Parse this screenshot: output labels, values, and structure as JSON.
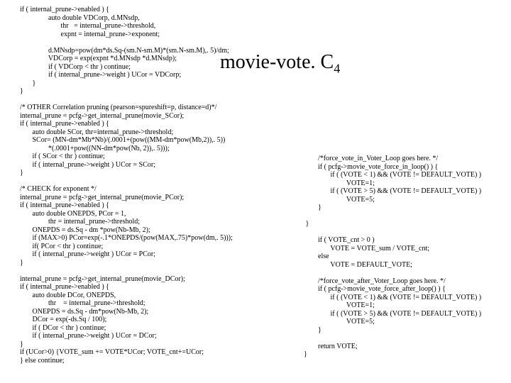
{
  "title_main": "movie-vote. C",
  "title_sub": "4",
  "code_left": "        if ( internal_prune->enabled ) {\n                        auto double VDCorp, d.MNsdp,\n                               thr   = internal_prune->threshold,\n                               expnt = internal_prune->exponent;\n\n                        d.MNsdp=pow(dm*ds.Sq-(sm.N-sm.M)*(sm.N-sm.M),. 5)/dm;\n                        VDCorp = exp(expnt *d.MNsdp *d.MNsdp);\n                        if ( VDCorp < thr ) continue;\n                        if ( internal_prune->weight ) UCor = VDCorp;\n               }\n        }\n\n        /* OTHER Correlation pruning (pearson=spureshift=p, distance=d)*/\n        internal_prune = pcfg->get_internal_prune(movie_SCor);\n        if ( internal_prune->enabled ) {\n               auto double SCor, thr=internal_prune->threshold;\n               SCor= (MN-dm*Mb*Nb)/(.0001+(pow((MM-dm*pow(Mb,2)),. 5))\n                        *(.0001+pow((NN-dm*pow(Nb, 2)),. 5)));\n               if ( SCor < thr ) continue;\n               if ( internal_prune->weight ) UCor = SCor;\n        }\n\n        /* CHECK for exponent */\n        internal_prune = pcfg->get_internal_prune(movie_PCor);\n        if ( internal_prune->enabled ) {\n               auto double ONEPDS, PCor = 1,\n                        thr = internal_prune->threshold;\n               ONEPDS = ds.Sq - dm *pow(Nb-Mb, 2);\n               if (MAX>0) PCor=exp(-.1*ONEPDS/(pow(MAX,.75)*pow(dm,. 5)));\n               if( PCor < thr ) continue;\n               if ( internal_prune->weight ) UCor = PCor;\n        }\n\n        internal_prune = pcfg->get_internal_prune(movie_DCor);\n        if ( internal_prune->enabled ) {\n               auto double DCor, ONEPDS,\n                        thr    = internal_prune->threshold;\n               ONEPDS = ds.Sq - dm*pow(Nb-Mb, 2);\n               DCor = exp(-ds.Sq / 100);\n               if ( DCor < thr ) continue;\n               if ( internal_prune->weight ) UCor = DCor;\n        }\n        if (UCor>0) {VOTE_sum += VOTE*UCor; VOTE_cnt+=UCor;\n        } else continue;",
  "code_right": "        /*force_vote_in_Voter_Loop goes here. */\n        if ( pcfg->movie_vote_force_in_loop() ) {\n               if ( (VOTE < 1) && (VOTE != DEFAULT_VOTE) )\n                        VOTE=1;\n               if ( (VOTE > 5) && (VOTE != DEFAULT_VOTE) )\n                        VOTE=5;\n        }\n\n }\n\n        if ( VOTE_cnt > 0 )\n               VOTE = VOTE_sum / VOTE_cnt;\n        else\n               VOTE = DEFAULT_VOTE;\n\n        /*force_vote_after_Voter_Loop goes here. */\n        if ( pcfg->movie_vote_force_after_loop() ) {\n               if ( (VOTE < 1) && (VOTE != DEFAULT_VOTE) )\n                        VOTE=1;\n               if ( (VOTE > 5) && (VOTE != DEFAULT_VOTE) )\n                        VOTE=5;\n        }\n\n        return VOTE;\n}"
}
